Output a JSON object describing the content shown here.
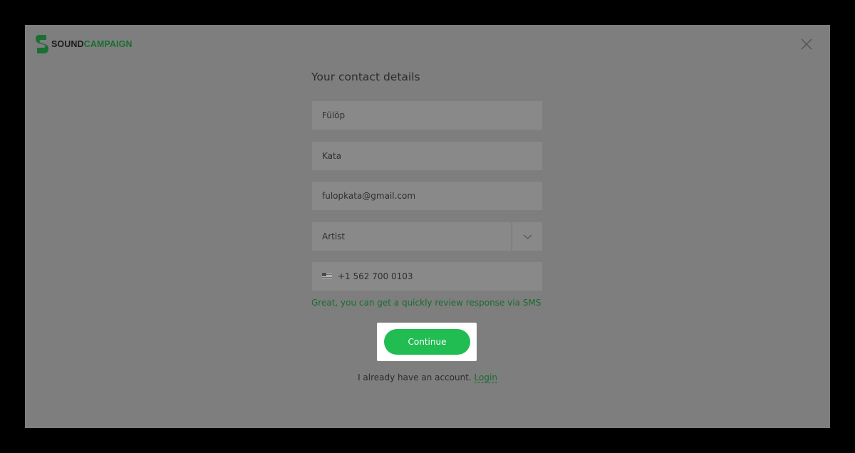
{
  "brand": {
    "name_part1": "SOUND",
    "name_part2": "CAMPAIGN",
    "color": "#1a6f33"
  },
  "modal": {
    "title": "Your contact details",
    "close_icon": "close-icon"
  },
  "form": {
    "first_name": "Fülöp",
    "last_name": "Kata",
    "email": "fulopkata@gmail.com",
    "role": {
      "selected": "Artist",
      "icon": "chevron-down-icon"
    },
    "phone": {
      "flag_icon": "flag-icon",
      "value": "+1 562 700 0103"
    },
    "sms_note": "Great, you can get a quickly review response via SMS",
    "continue_label": "Continue"
  },
  "footer": {
    "account_text": "I already have an account.",
    "login_label": "Login"
  },
  "colors": {
    "button": "#21bc52",
    "link": "#186c30",
    "overlay": "#7e7e7e"
  }
}
